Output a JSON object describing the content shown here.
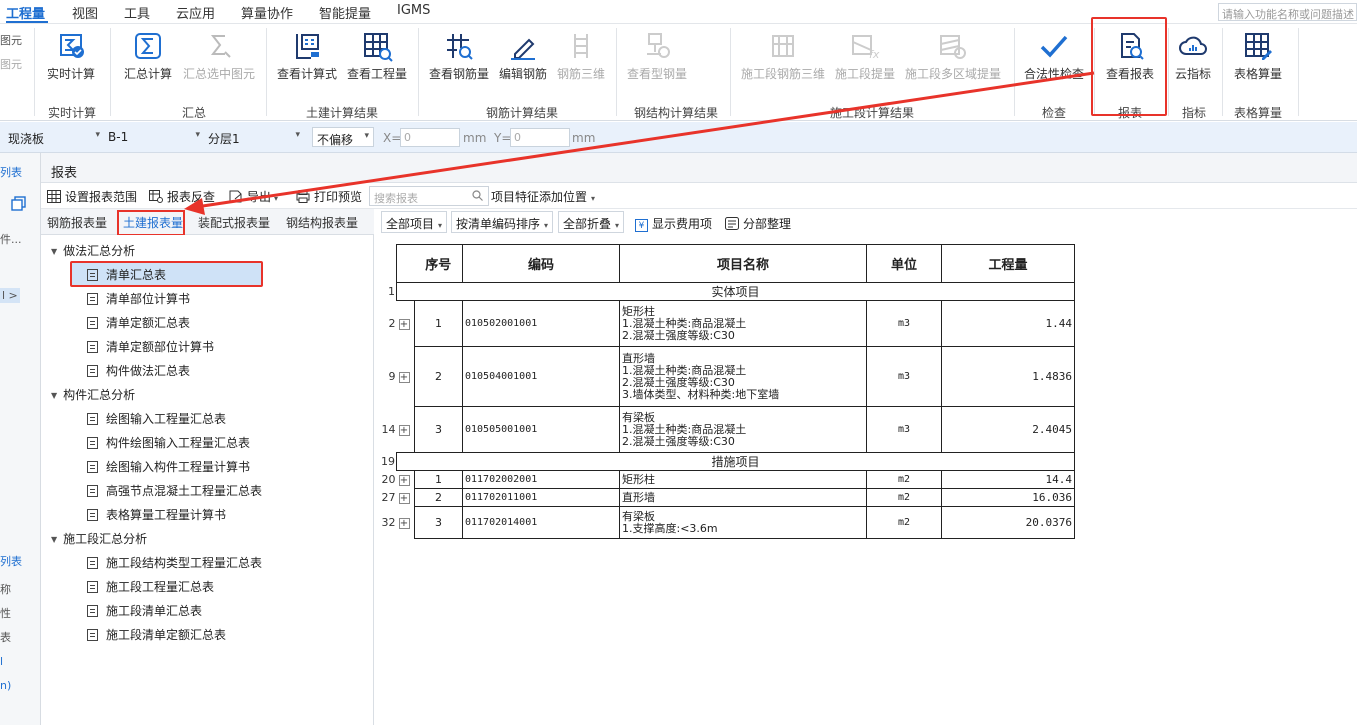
{
  "menu": {
    "items": [
      "工程量",
      "视图",
      "工具",
      "云应用",
      "算量协作",
      "智能提量",
      "IGMS"
    ],
    "search_placeholder": "请输入功能名称或问题描述"
  },
  "ribbon": {
    "left_stub": [
      "图元",
      "图元"
    ],
    "buttons": [
      {
        "label": "实时计算",
        "icon": "realtime-calc-icon",
        "enabled": true
      },
      {
        "label": "汇总计算",
        "icon": "sum-calc-icon",
        "enabled": true
      },
      {
        "label": "汇总选中图元",
        "icon": "sum-selected-icon",
        "enabled": false
      },
      {
        "label": "查看计算式",
        "icon": "view-formula-icon",
        "enabled": true
      },
      {
        "label": "查看工程量",
        "icon": "view-quantity-icon",
        "enabled": true
      },
      {
        "label": "查看钢筋量",
        "icon": "view-rebar-icon",
        "enabled": true
      },
      {
        "label": "编辑钢筋",
        "icon": "edit-rebar-icon",
        "enabled": true
      },
      {
        "label": "钢筋三维",
        "icon": "rebar-3d-icon",
        "enabled": false
      },
      {
        "label": "查看型钢量",
        "icon": "view-steel-icon",
        "enabled": false
      },
      {
        "label": "施工段钢筋三维",
        "icon": "stage-rebar-3d-icon",
        "enabled": false
      },
      {
        "label": "施工段提量",
        "icon": "stage-extract-icon",
        "enabled": false
      },
      {
        "label": "施工段多区域提量",
        "icon": "stage-multi-area-icon",
        "enabled": false
      },
      {
        "label": "合法性检查",
        "icon": "check-icon",
        "enabled": true
      },
      {
        "label": "查看报表",
        "icon": "view-report-icon",
        "enabled": true
      },
      {
        "label": "云指标",
        "icon": "cloud-index-icon",
        "enabled": true
      },
      {
        "label": "表格算量",
        "icon": "table-calc-icon",
        "enabled": true
      }
    ],
    "groups": [
      "实时计算",
      "汇总",
      "土建计算结果",
      "钢筋计算结果",
      "钢结构计算结果",
      "施工段计算结果",
      "检查",
      "报表",
      "指标",
      "表格算量"
    ]
  },
  "propbar": {
    "type": "现浇板",
    "name": "B-1",
    "layer": "分层1",
    "offset": "不偏移",
    "x_label": "X=",
    "x_value": "0",
    "y_label": "Y=",
    "y_value": "0",
    "unit": "mm"
  },
  "leftstrip": [
    "列表",
    "件...",
    "列表",
    "称",
    "性",
    "表",
    "l",
    "n)"
  ],
  "panel": {
    "title": "报表",
    "toolbar": {
      "set_range": "设置报表范围",
      "reverse": "报表反查",
      "export": "导出",
      "print": "打印预览",
      "search_placeholder": "搜索报表",
      "feature_pos": "项目特征添加位置"
    },
    "tabs": [
      "钢筋报表量",
      "土建报表量",
      "装配式报表量",
      "钢结构报表量"
    ],
    "tree": [
      {
        "group": "做法汇总分析",
        "items": [
          "清单汇总表",
          "清单部位计算书",
          "清单定额汇总表",
          "清单定额部位计算书",
          "构件做法汇总表"
        ]
      },
      {
        "group": "构件汇总分析",
        "items": [
          "绘图输入工程量汇总表",
          "构件绘图输入工程量汇总表",
          "绘图输入构件工程量计算书",
          "高强节点混凝土工程量汇总表",
          "表格算量工程量计算书"
        ]
      },
      {
        "group": "施工段汇总分析",
        "items": [
          "施工段结构类型工程量汇总表",
          "施工段工程量汇总表",
          "施工段清单汇总表",
          "施工段清单定额汇总表"
        ]
      }
    ],
    "right_toolbar": {
      "all_items": "全部项目",
      "sort": "按清单编码排序",
      "fold": "全部折叠",
      "show_fee": "显示费用项",
      "sub_arrange": "分部整理"
    }
  },
  "table": {
    "headers": [
      "序号",
      "编码",
      "项目名称",
      "单位",
      "工程量"
    ],
    "rows": [
      {
        "rownum": "1",
        "section": "实体项目"
      },
      {
        "rownum": "2",
        "seq": "1",
        "code": "010502001001",
        "name": [
          "矩形柱",
          "1.混凝土种类:商品混凝土",
          "2.混凝土强度等级:C30"
        ],
        "unit": "m3",
        "qty": "1.44"
      },
      {
        "rownum": "9",
        "seq": "2",
        "code": "010504001001",
        "name": [
          "直形墙",
          "1.混凝土种类:商品混凝土",
          "2.混凝土强度等级:C30",
          "3.墙体类型、材料种类:地下室墙"
        ],
        "unit": "m3",
        "qty": "1.4836"
      },
      {
        "rownum": "14",
        "seq": "3",
        "code": "010505001001",
        "name": [
          "有梁板",
          "1.混凝土种类:商品混凝土",
          "2.混凝土强度等级:C30"
        ],
        "unit": "m3",
        "qty": "2.4045"
      },
      {
        "rownum": "19",
        "section": "措施项目"
      },
      {
        "rownum": "20",
        "seq": "1",
        "code": "011702002001",
        "name": [
          "矩形柱"
        ],
        "unit": "m2",
        "qty": "14.4"
      },
      {
        "rownum": "27",
        "seq": "2",
        "code": "011702011001",
        "name": [
          "直形墙"
        ],
        "unit": "m2",
        "qty": "16.036"
      },
      {
        "rownum": "32",
        "seq": "3",
        "code": "011702014001",
        "name": [
          "有梁板",
          "1.支撑高度:<3.6m"
        ],
        "unit": "m2",
        "qty": "20.0376"
      }
    ]
  },
  "colors": {
    "accent": "#1f6fd1",
    "annotation": "#e8332a"
  }
}
